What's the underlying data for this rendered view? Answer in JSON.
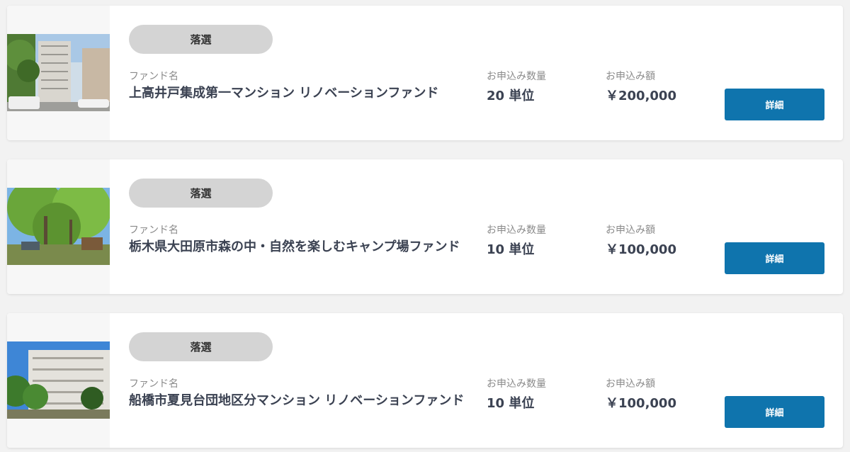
{
  "funds": [
    {
      "status": "落選",
      "fund_label": "ファンド名",
      "name": "上高井戸集成第一マンション リノベーションファンド",
      "qty_label": "お申込み数量",
      "qty": "20 単位",
      "amount_label": "お申込み額",
      "amount": "￥200,000",
      "button": "詳細"
    },
    {
      "status": "落選",
      "fund_label": "ファンド名",
      "name": "栃木県大田原市森の中・自然を楽しむキャンプ場ファンド",
      "qty_label": "お申込み数量",
      "qty": "10 単位",
      "amount_label": "お申込み額",
      "amount": "￥100,000",
      "button": "詳細"
    },
    {
      "status": "落選",
      "fund_label": "ファンド名",
      "name": "船橋市夏見台団地区分マンション リノベーションファンド",
      "qty_label": "お申込み数量",
      "qty": "10 単位",
      "amount_label": "お申込み額",
      "amount": "￥100,000",
      "button": "詳細"
    }
  ],
  "colors": {
    "button_bg": "#0f74ad",
    "badge_bg": "#d4d4d4",
    "page_bg": "#f2f2f2"
  }
}
